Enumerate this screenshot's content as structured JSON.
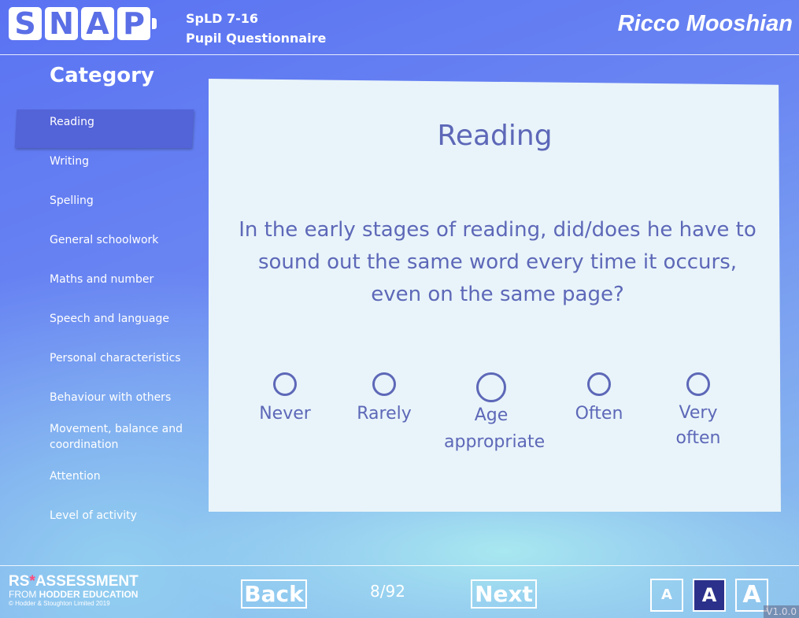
{
  "header": {
    "logo_letters": [
      "S",
      "N",
      "A",
      "P"
    ],
    "product_line1": "SpLD 7-16",
    "product_line2": "Pupil Questionnaire",
    "user_name": "Ricco Mooshian"
  },
  "sidebar": {
    "title": "Category",
    "items": [
      {
        "label": "Reading",
        "active": true
      },
      {
        "label": "Writing",
        "active": false
      },
      {
        "label": "Spelling",
        "active": false
      },
      {
        "label": "General schoolwork",
        "active": false
      },
      {
        "label": "Maths and number",
        "active": false
      },
      {
        "label": "Speech and language",
        "active": false
      },
      {
        "label": "Personal characteristics",
        "active": false
      },
      {
        "label": "Behaviour with others",
        "active": false
      },
      {
        "label": "Movement, balance and coordination",
        "active": false
      },
      {
        "label": "Attention",
        "active": false
      },
      {
        "label": "Level of activity",
        "active": false
      }
    ]
  },
  "card": {
    "title": "Reading",
    "question": "In the early stages of reading, did/does he have to sound out the same word every time it occurs, even on the same page?",
    "options": [
      "Never",
      "Rarely",
      "Age appropriate",
      "Often",
      "Very often"
    ]
  },
  "footer": {
    "brand_line1_a": "RS",
    "brand_line1_b": "ASSESSMENT",
    "brand_line2_a": "FROM ",
    "brand_line2_b": "HODDER EDUCATION",
    "brand_line3": "© Hodder & Stoughton Limited 2019",
    "back_label": "Back",
    "page_counter": "8/92",
    "next_label": "Next",
    "text_size_labels": [
      "A",
      "A",
      "A"
    ],
    "text_size_selected": 1,
    "version": "V1.0.0"
  },
  "colors": {
    "accent_text": "#5d68b8",
    "active_category": "#5363d8",
    "card_bg": "#e9f4fa",
    "selected_size_bg": "#2b318a"
  }
}
